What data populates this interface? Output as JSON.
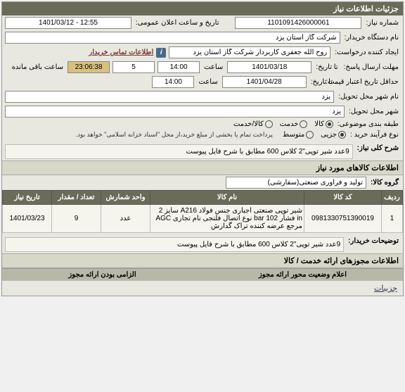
{
  "panel_title": "جزئیات اطلاعات نیاز",
  "fields": {
    "need_no_label": "شماره نیاز:",
    "need_no": "1101091426000061",
    "public_datetime_label": "تاریخ و ساعت اعلان عمومی:",
    "public_datetime": "1401/03/12 - 12:55",
    "buyer_label": "نام دستگاه خریدار:",
    "buyer": "شرکت گاز استان یزد",
    "requester_label": "ایجاد کننده درخواست:",
    "requester": "روح الله جعفری کاربردار شرکت گاز استان یزد",
    "contact_link": "اطلاعات تماس خریدار",
    "deadline_label": "مهلت ارسال پاسخ:",
    "deadline_until": "تا تاریخ:",
    "deadline_date": "1401/03/18",
    "time_label": "ساعت",
    "deadline_time": "14:00",
    "days_label": "",
    "days_value": "5",
    "remaining_label": "ساعت باقی مانده",
    "remaining_time": "23:06:38",
    "validity_label": "حداقل تاریخ اعتبار قیمت:",
    "validity_until": "تا تاریخ:",
    "validity_date": "1401/04/28",
    "validity_time": "14:00",
    "need_city_label": "نام شهر محل تحویل:",
    "need_city": "یزد",
    "delivery_city_label": "شهر محل تحویل:",
    "delivery_city": "یزد",
    "class_label": "طبقه بندی موضوعی:",
    "class_kala": "کالا",
    "class_khadamat": "خدمت",
    "class_kalakhadamat": "کالا/خدمت",
    "buy_type_label": "نوع فرآیند خرید :",
    "buy_minor": "جزیی",
    "buy_medium": "متوسط",
    "payment_note": "پرداخت تمام یا بخشی از مبلغ خرید،از محل \"اسناد خزانه اسلامی\" خواهد بود.",
    "summary_label": "شرح کلی نیاز:",
    "summary": "9عدد  شیر توپی\"2 کلاس 600 مطابق با شرح فایل پیوست",
    "items_title": "اطلاعات کالاهای مورد نیاز",
    "group_label": "گروه کالا:",
    "group_value": "تولید و فرآوری صنعتی(سفارشی)",
    "buyer_note_label": "توضیحات خریدار:",
    "buyer_note": "9عدد  شیر توپی\"2 کلاس 600 مطابق با شرح فایل پیوست",
    "license_title": "اطلاعات مجوزهای ارائه خدمت / کالا",
    "status_title": "اعلام وضعیت محور ارائه مجوز",
    "mandatory_title": "الزامی بودن ارائه مجوز"
  },
  "columns": {
    "row": "ردیف",
    "code": "کد کالا",
    "name": "نام کالا",
    "unit": "واحد شمارش",
    "qty": "تعداد / مقدار",
    "date": "تاریخ نیاز"
  },
  "items": [
    {
      "row": "1",
      "code": "0981330751390019",
      "name": "شیر توپی صنعتی اجباری جنس فولاد A216 سایز 2 in فشار 102 bar نوع اتصال فلنجی نام تجاری AGC مرجع عرضه کننده تراک گدارش",
      "unit": "عدد",
      "qty": "9",
      "date": "1401/03/23"
    }
  ],
  "footer": {
    "details": "جزیبات"
  }
}
